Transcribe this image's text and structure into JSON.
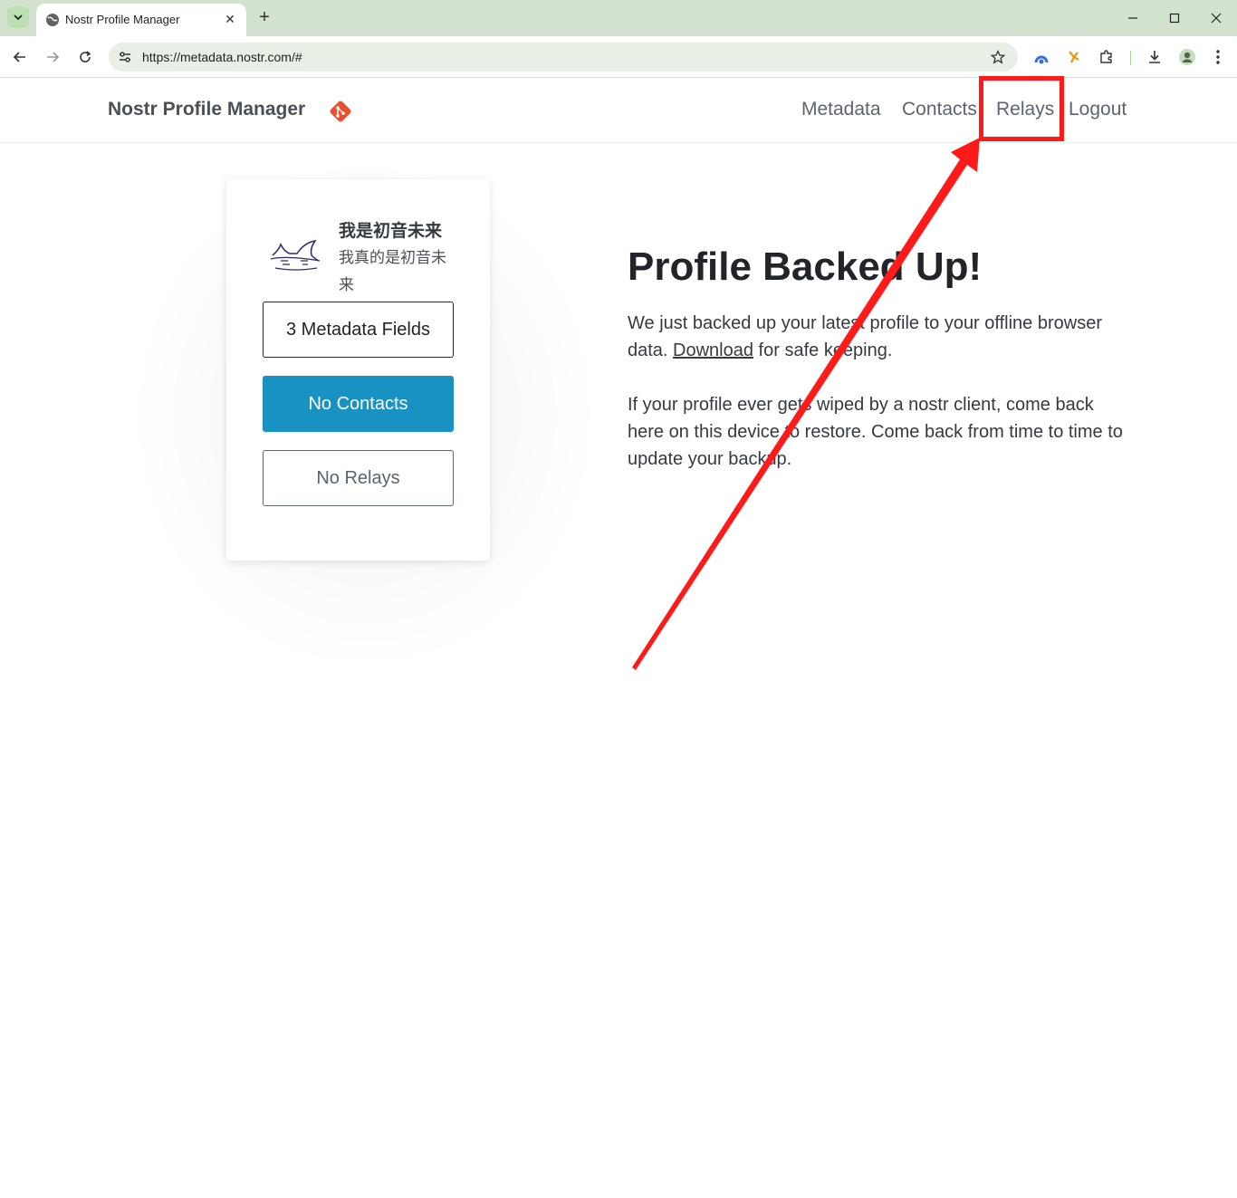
{
  "browser": {
    "tab_title": "Nostr Profile Manager",
    "url": "https://metadata.nostr.com/#",
    "new_tab_symbol": "+",
    "close_symbol": "✕"
  },
  "site": {
    "brand": "Nostr Profile Manager",
    "nav": {
      "metadata": "Metadata",
      "contacts": "Contacts",
      "relays": "Relays",
      "logout": "Logout"
    }
  },
  "profile_card": {
    "name": "我是初音未来",
    "about": "我真的是初音未来",
    "metadata_button": "3 Metadata Fields",
    "contacts_button": "No Contacts",
    "relays_button": "No Relays"
  },
  "main": {
    "headline": "Profile Backed Up!",
    "para1_before": "We just backed up your latest profile to your offline browser data. ",
    "para1_link": "Download",
    "para1_after": " for safe keeping.",
    "para2": "If your profile ever gets wiped by a nostr client, come back here on this device to restore. Come back from time to time to update your backup."
  },
  "colors": {
    "accent_blue": "#1892c2",
    "annotation_red": "#ff1a1a",
    "brand_orange": "#e8502e"
  }
}
